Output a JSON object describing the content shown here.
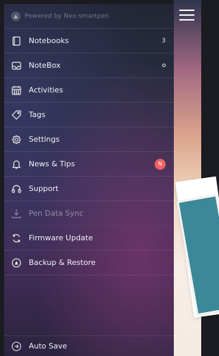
{
  "brand": {
    "text": "Powered by Neo smartpen",
    "icon": "neo-logo-icon"
  },
  "menu": [
    {
      "id": "notebooks",
      "label": "Notebooks",
      "icon": "notebook-icon",
      "count": "3"
    },
    {
      "id": "notebox",
      "label": "NoteBox",
      "icon": "inbox-icon",
      "indicator": "dot"
    },
    {
      "id": "activities",
      "label": "Activities",
      "icon": "calendar-icon"
    },
    {
      "id": "tags",
      "label": "Tags",
      "icon": "tag-icon"
    },
    {
      "id": "settings",
      "label": "Settings",
      "icon": "gear-icon"
    },
    {
      "id": "news",
      "label": "News & Tips",
      "icon": "bell-icon",
      "badge": "N",
      "badge_color": "#f0615f"
    },
    {
      "id": "support",
      "label": "Support",
      "icon": "headset-icon"
    },
    {
      "id": "pen-sync",
      "label": "Pen Data Sync",
      "icon": "download-icon",
      "disabled": true
    },
    {
      "id": "firmware",
      "label": "Firmware Update",
      "icon": "refresh-icon"
    },
    {
      "id": "backup",
      "label": "Backup & Restore",
      "icon": "drive-icon"
    }
  ],
  "bottom": {
    "label": "Auto Save",
    "icon": "save-arrow-icon"
  },
  "colors": {
    "accent_badge": "#f0615f"
  }
}
